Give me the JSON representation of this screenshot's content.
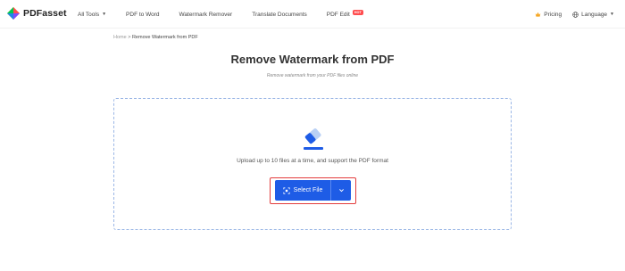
{
  "app": {
    "name": "PDFasset"
  },
  "nav": {
    "items": [
      {
        "label": "All Tools"
      },
      {
        "label": "PDF to Word"
      },
      {
        "label": "Watermark Remover"
      },
      {
        "label": "Translate Documents"
      },
      {
        "label": "PDF Edit",
        "badge": "HOT"
      }
    ],
    "pricing": "Pricing",
    "language": "Language"
  },
  "breadcrumb": {
    "home": "Home",
    "separator": ">",
    "current": "Remove Watermark from PDF"
  },
  "page": {
    "title": "Remove Watermark from PDF",
    "subtitle": "Remove watermark from your PDF files online"
  },
  "upload": {
    "hint": "Upload up to 10 files at a time, and support the PDF format",
    "select_label": "Select File",
    "icon": "eraser-icon"
  },
  "colors": {
    "accent": "#1e5ce6",
    "highlight_outline": "#e33b3b",
    "dashed_border": "#9bb7e6"
  }
}
